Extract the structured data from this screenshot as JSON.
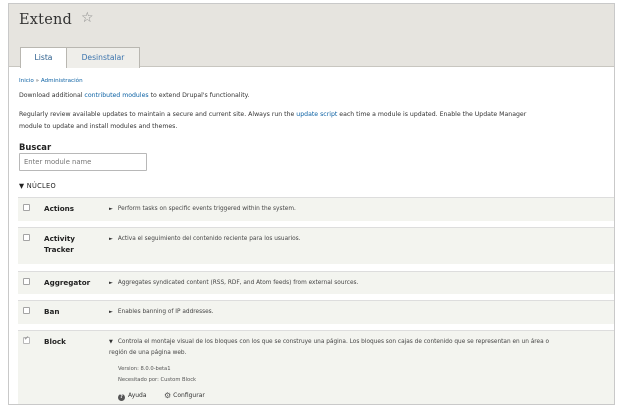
{
  "header": {
    "title": "Extend",
    "star_icon": "star-outline-icon",
    "tabs": [
      {
        "label": "Lista",
        "active": true
      },
      {
        "label": "Desinstalar",
        "active": false
      }
    ]
  },
  "breadcrumb": {
    "home": "Inicio",
    "separator": "»",
    "admin": "Administración"
  },
  "intro": {
    "line1_pre": "Download additional ",
    "line1_link": "contributed modules",
    "line1_post": " to extend Drupal's functionality.",
    "line2_pre": "Regularly review available updates to maintain a secure and current site. Always run the ",
    "line2_link": "update script",
    "line2_post": " each time a module is updated. Enable the Update Manager",
    "line3": "module to update and install modules and themes."
  },
  "search": {
    "label": "Buscar",
    "placeholder": "Enter module name"
  },
  "section": {
    "toggle": "▼",
    "label": "NÚCLEO"
  },
  "modules": [
    {
      "name": "Actions",
      "description": "Perform tasks on specific events triggered within the system.",
      "checked": false
    },
    {
      "name_line1": "Activity",
      "name_line2": "Tracker",
      "description": "Activa el seguimiento del contenido reciente para los usuarios.",
      "checked": false
    },
    {
      "name": "Aggregator",
      "description": "Aggregates syndicated content (RSS, RDF, and Atom feeds) from external sources.",
      "checked": false
    },
    {
      "name": "Ban",
      "description": "Enables banning of IP addresses.",
      "checked": false
    },
    {
      "name": "Block",
      "description_line1": "Controla el montaje visual de los bloques con los que se construye una página. Los bloques son cajas de contenido que se representan en un área o",
      "description_line2": "región de una página web.",
      "version": "Version: 8.0.0-beta1",
      "required_by": "Necesitado por: Custom Block",
      "help_label": "Ayuda",
      "configure_label": "Configurar",
      "checked": true
    }
  ],
  "glyphs": {
    "collapsed_arrow": "►",
    "expanded_arrow": "▼",
    "help_icon": "?",
    "gear_icon": "⚙",
    "star": "☆"
  }
}
